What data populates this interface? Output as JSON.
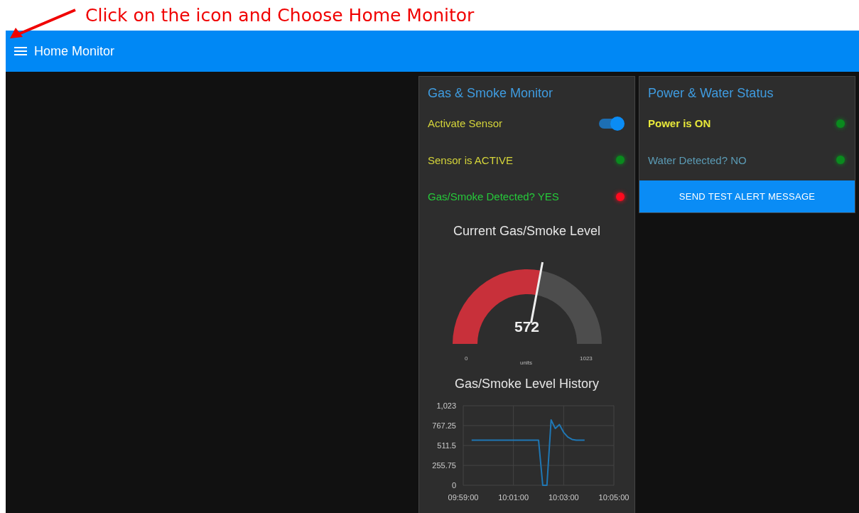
{
  "annotation": {
    "text": "Click on the icon and Choose Home Monitor"
  },
  "header": {
    "title": "Home Monitor"
  },
  "gas_card": {
    "title": "Gas & Smoke Monitor",
    "rows": [
      {
        "kind": "switch",
        "label": {
          "text": "Activate Sensor",
          "color": "#d4d43a"
        },
        "on": true
      },
      {
        "kind": "led",
        "label": {
          "text": "Sensor is ACTIVE",
          "color": "#d4d43a"
        },
        "color": "#0a8a1e"
      },
      {
        "kind": "led",
        "label": {
          "text": "Gas/Smoke Detected? YES",
          "color": "#26c93a"
        },
        "color": "#ff0a1e"
      }
    ],
    "gauge": {
      "title": "Current Gas/Smoke Level",
      "value": "572",
      "units": "units",
      "min": "0",
      "max": "1023",
      "level": 0.559
    },
    "history": {
      "title": "Gas/Smoke Level History",
      "chart_data": {
        "type": "line",
        "categories": [
          "09:59:00",
          null,
          null,
          null,
          null,
          null,
          null,
          null,
          null,
          null,
          null,
          null,
          "10:01:00",
          null,
          null,
          null,
          null,
          null,
          null,
          null,
          null,
          null,
          null,
          null,
          "10:03:00",
          null,
          null,
          null,
          null,
          null,
          null,
          null,
          null,
          null,
          null,
          null,
          "10:05:00"
        ],
        "series": [
          {
            "color": "#1f77b4",
            "values": [
              null,
              null,
              580,
              580,
              580,
              580,
              580,
              580,
              580,
              580,
              580,
              580,
              580,
              580,
              580,
              580,
              580,
              580,
              580,
              0,
              0,
              840,
              730,
              780,
              680,
              620,
              590,
              580,
              580,
              580,
              null,
              null,
              null,
              null,
              null,
              null,
              null
            ]
          }
        ],
        "ylim": [
          0,
          1023
        ],
        "grid": true,
        "yticks": [
          {
            "value": 0,
            "label": "0"
          },
          {
            "value": 255.75,
            "label": "255.75"
          },
          {
            "value": 511.5,
            "label": "511.5"
          },
          {
            "value": 767.25,
            "label": "767.25"
          },
          {
            "value": 1023,
            "label": "1,023"
          }
        ]
      }
    }
  },
  "power_card": {
    "title": "Power & Water Status",
    "rows": [
      {
        "label": {
          "text": "Power is ON",
          "bold": true,
          "color": "#e8e83a"
        },
        "color": "#0a8a1e"
      },
      {
        "label": {
          "text": "Water Detected? NO",
          "bold": false,
          "color": "#5b9bb5"
        },
        "color": "#0a8a1e"
      }
    ],
    "button": "SEND TEST ALERT MESSAGE"
  }
}
